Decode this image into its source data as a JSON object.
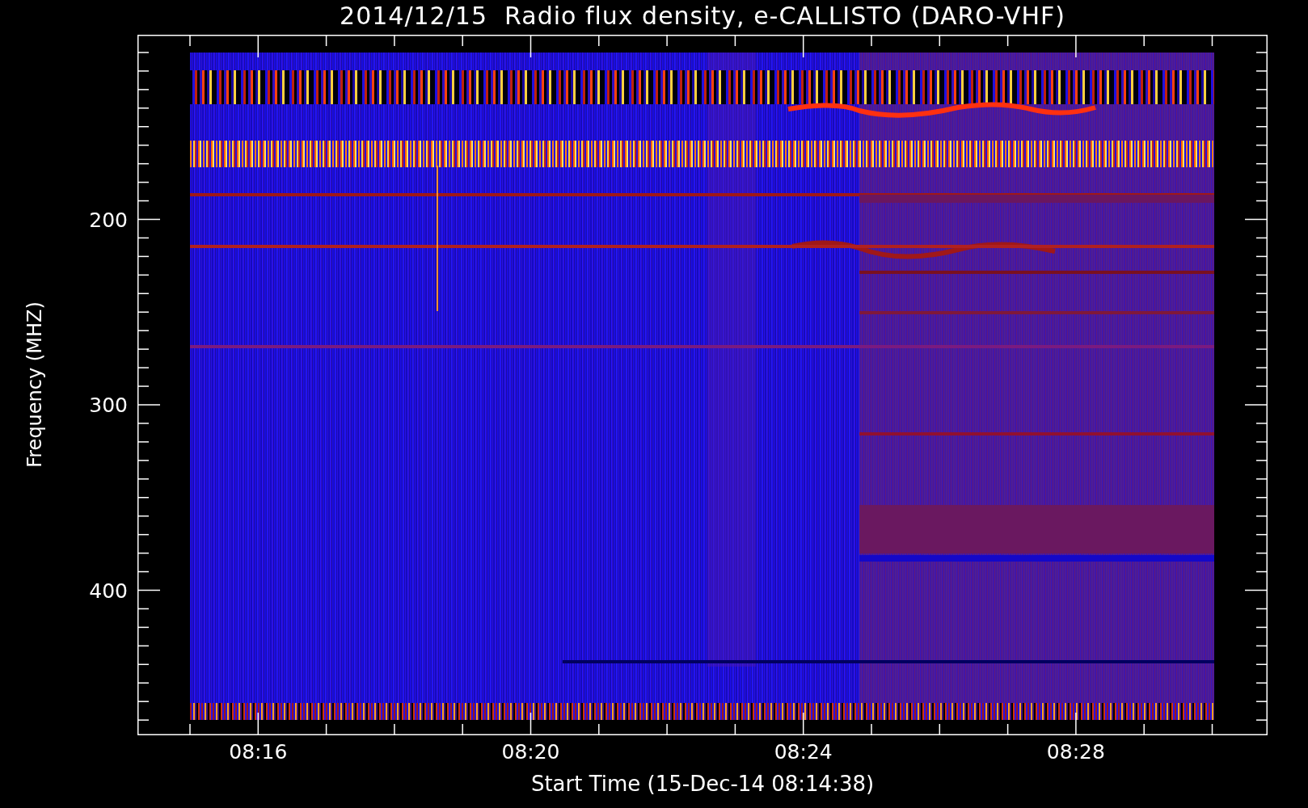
{
  "title": "2014/12/15  Radio flux density, e-CALLISTO (DARO-VHF)",
  "y_axis": {
    "label": "Frequency (MHZ)",
    "ticks": [
      "200",
      "300",
      "400"
    ]
  },
  "x_axis": {
    "label": "Start Time (15-Dec-14 08:14:38)",
    "ticks": [
      "08:16",
      "08:20",
      "08:24",
      "08:28"
    ]
  }
}
